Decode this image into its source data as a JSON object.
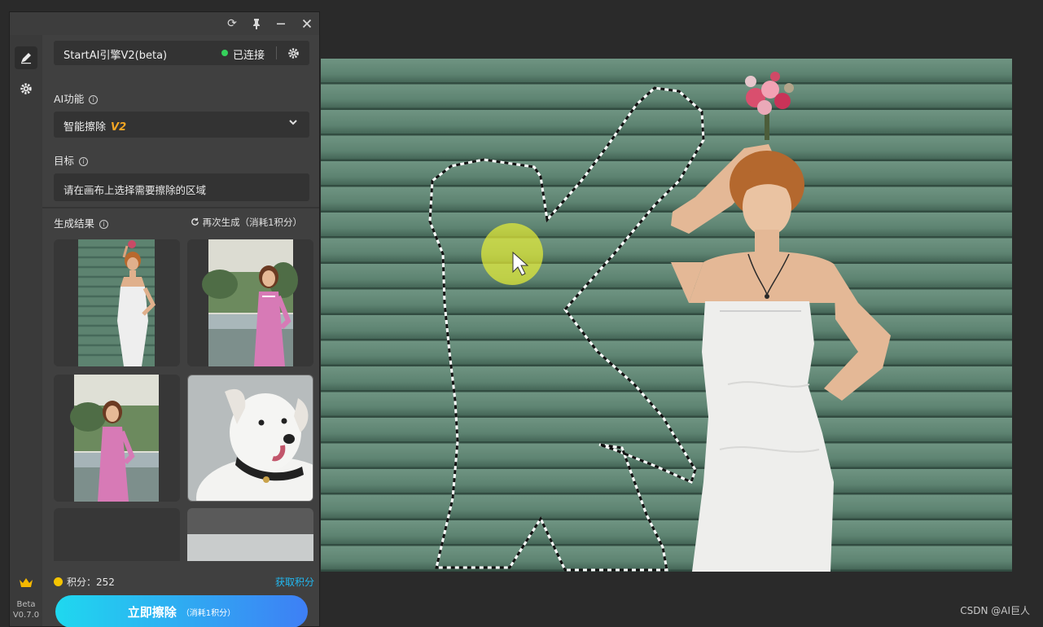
{
  "panel": {
    "engine": {
      "name": "StartAI引擎V2(beta)",
      "status": "已连接",
      "status_color": "#35d15b"
    },
    "ai_function": {
      "label": "AI功能",
      "selected": "智能擦除",
      "version_tag": "V2"
    },
    "target": {
      "label": "目标",
      "hint": "请在画布上选择需要擦除的区域"
    },
    "results": {
      "label": "生成结果",
      "regenerate": "再次生成（消耗1积分）"
    },
    "credits": {
      "label": "积分：",
      "value": "252",
      "get_link": "获取积分"
    },
    "erase_button": {
      "label": "立即擦除",
      "cost": "（消耗1积分）"
    },
    "sidebar": {
      "beta": "Beta",
      "version": "V0.7.0"
    },
    "accent_color": "#22b8f0"
  },
  "icons": [
    "refresh-icon",
    "pin-icon",
    "minimize-icon",
    "close-icon",
    "brush-icon",
    "settings-icon",
    "crown-icon",
    "info-icon",
    "chevron-down-icon",
    "gear-icon",
    "refresh-small-icon",
    "coin-icon",
    "cursor-icon"
  ],
  "watermark": "CSDN @AI巨人"
}
